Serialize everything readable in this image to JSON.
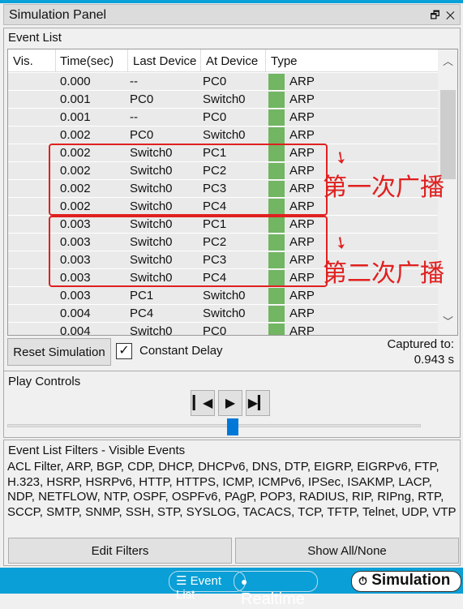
{
  "panel": {
    "title": "Simulation Panel",
    "restore_icon": "restore-icon",
    "close_icon": "close-icon"
  },
  "event_list": {
    "label": "Event List",
    "columns": [
      "Vis.",
      "Time(sec)",
      "Last Device",
      "At Device",
      "Type"
    ],
    "rows": [
      {
        "time": "0.000",
        "last": "--",
        "at": "PC0",
        "type": "ARP",
        "color": "#72b563"
      },
      {
        "time": "0.001",
        "last": "PC0",
        "at": "Switch0",
        "type": "ARP",
        "color": "#72b563"
      },
      {
        "time": "0.001",
        "last": "--",
        "at": "PC0",
        "type": "ARP",
        "color": "#72b563"
      },
      {
        "time": "0.002",
        "last": "PC0",
        "at": "Switch0",
        "type": "ARP",
        "color": "#72b563"
      },
      {
        "time": "0.002",
        "last": "Switch0",
        "at": "PC1",
        "type": "ARP",
        "color": "#72b563"
      },
      {
        "time": "0.002",
        "last": "Switch0",
        "at": "PC2",
        "type": "ARP",
        "color": "#72b563"
      },
      {
        "time": "0.002",
        "last": "Switch0",
        "at": "PC3",
        "type": "ARP",
        "color": "#72b563"
      },
      {
        "time": "0.002",
        "last": "Switch0",
        "at": "PC4",
        "type": "ARP",
        "color": "#72b563"
      },
      {
        "time": "0.003",
        "last": "Switch0",
        "at": "PC1",
        "type": "ARP",
        "color": "#72b563"
      },
      {
        "time": "0.003",
        "last": "Switch0",
        "at": "PC2",
        "type": "ARP",
        "color": "#72b563"
      },
      {
        "time": "0.003",
        "last": "Switch0",
        "at": "PC3",
        "type": "ARP",
        "color": "#72b563"
      },
      {
        "time": "0.003",
        "last": "Switch0",
        "at": "PC4",
        "type": "ARP",
        "color": "#72b563"
      },
      {
        "time": "0.003",
        "last": "PC1",
        "at": "Switch0",
        "type": "ARP",
        "color": "#72b563"
      },
      {
        "time": "0.004",
        "last": "PC4",
        "at": "Switch0",
        "type": "ARP",
        "color": "#72b563"
      },
      {
        "time": "0.004",
        "last": "Switch0",
        "at": "PC0",
        "type": "ARP",
        "color": "#72b563"
      }
    ],
    "reset_label": "Reset Simulation",
    "constant_delay_label": "Constant Delay",
    "constant_delay_checked": true,
    "captured_label": "Captured to:",
    "captured_value": "0.943 s"
  },
  "annotations": {
    "first": "第一次广播",
    "second": "第二次广播"
  },
  "play": {
    "label": "Play Controls",
    "back_icon": "step-back-icon",
    "play_icon": "play-icon",
    "forward_icon": "step-forward-icon",
    "slider_percent": 50
  },
  "filters": {
    "label": "Event List Filters - Visible Events",
    "text": "ACL Filter, ARP, BGP, CDP, DHCP, DHCPv6, DNS, DTP, EIGRP, EIGRPv6, FTP, H.323, HSRP, HSRPv6, HTTP, HTTPS, ICMP, ICMPv6, IPSec, ISAKMP, LACP, NDP, NETFLOW, NTP, OSPF, OSPFv6, PAgP, POP3, RADIUS, RIP, RIPng, RTP, SCCP, SMTP, SNMP, SSH, STP, SYSLOG, TACACS, TCP, TFTP, Telnet, UDP, VTP",
    "edit_label": "Edit Filters",
    "show_label": "Show All/None"
  },
  "bottom_tabs": {
    "event_list": "Event List",
    "realtime": "Realtime",
    "simulation": "Simulation",
    "accent": "#0a9fd6"
  }
}
